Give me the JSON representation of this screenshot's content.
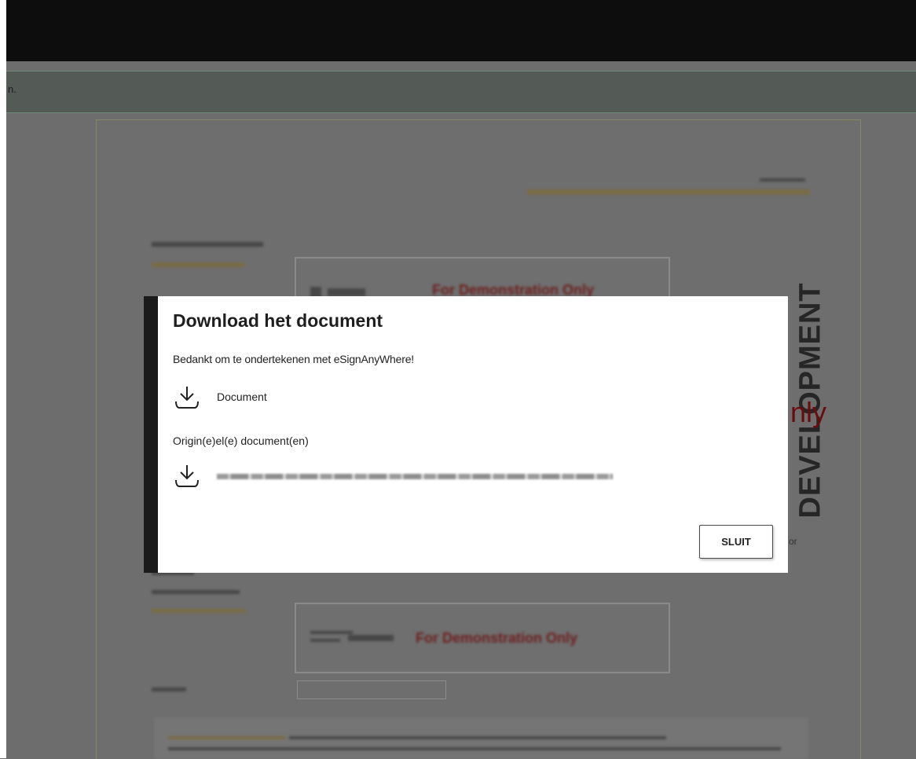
{
  "notice": {
    "text": "n."
  },
  "background_document": {
    "watermark": "DEVELOPMENT",
    "demo_stamp": "For Demonstration Only",
    "only_fragment": "nly",
    "or_fragment": "or"
  },
  "modal": {
    "title": "Download het document",
    "subtitle": "Bedankt om te ondertekenen met eSignAnyWhere!",
    "document_link": "Document",
    "originals_label": "Origin(e)el(e) document(en)",
    "close_label": "SLUIT"
  },
  "icons": {
    "download": "download-icon"
  }
}
